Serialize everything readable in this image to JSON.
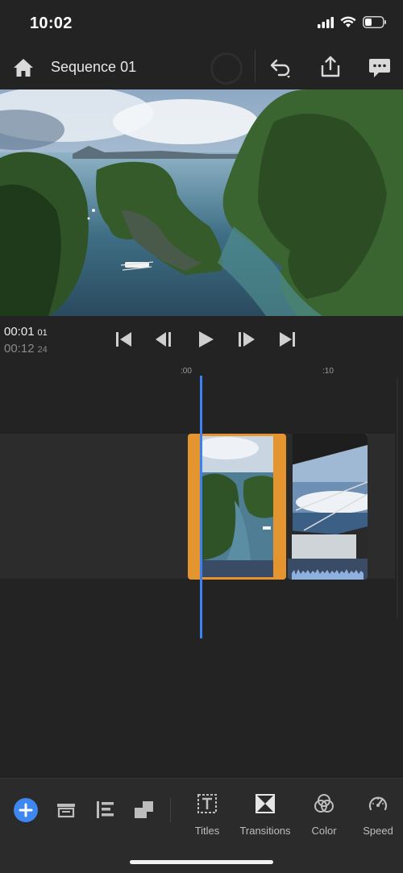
{
  "status_bar": {
    "time": "10:02",
    "icons": [
      "cellular-signal-icon",
      "wifi-icon",
      "battery-icon"
    ]
  },
  "toolbar": {
    "title": "Sequence 01",
    "icons": [
      "home-icon",
      "progress-ring",
      "undo-icon",
      "share-icon",
      "comment-icon"
    ]
  },
  "preview": {
    "description_icon": "video-preview"
  },
  "transport": {
    "current_time": "00:01",
    "current_frames": "01",
    "total_time": "00:12",
    "total_frames": "24",
    "buttons": [
      "skip-to-start-icon",
      "step-back-icon",
      "play-icon",
      "step-forward-icon",
      "skip-to-end-icon"
    ]
  },
  "timeline": {
    "ruler": [
      ":00",
      ":10"
    ]
  },
  "bottom_toolbar": {
    "icons": [
      "add-icon",
      "layers-icon",
      "align-icon",
      "crop-icon"
    ],
    "tools": [
      {
        "label": "Titles",
        "icon": "titles-icon"
      },
      {
        "label": "Transitions",
        "icon": "transitions-icon"
      },
      {
        "label": "Color",
        "icon": "color-icon"
      },
      {
        "label": "Speed",
        "icon": "speed-icon"
      }
    ]
  },
  "colors": {
    "accent": "#3e86f0",
    "playhead": "#3b82f0",
    "selected_clip": "#e5952f",
    "background": "#232323"
  }
}
